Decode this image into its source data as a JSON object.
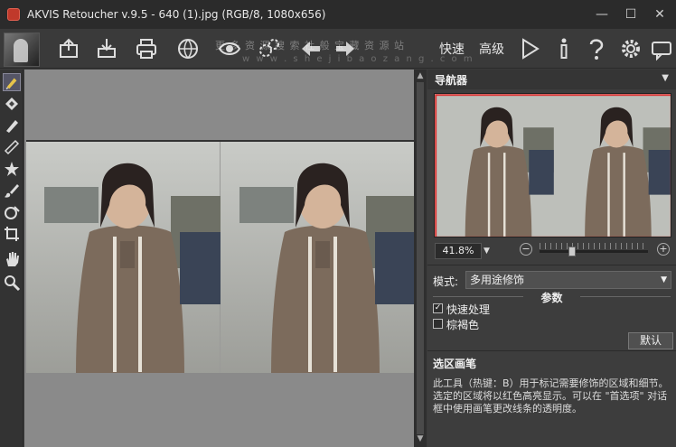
{
  "window": {
    "title": "AKVIS Retoucher v.9.5 - 640 (1).jpg (RGB/8, 1080x656)",
    "minimize": "—",
    "maximize": "☐",
    "close": "✕"
  },
  "toolbar": {
    "quick_label": "快速",
    "advanced_label": "高级",
    "watermark_top": "更 多 资 源 搜 索 社 般 宝 藏 资 源 站",
    "watermark_bottom": "w w w . s h e j i b a o z a n g . c o m"
  },
  "left_tools": [
    "selection-brush",
    "eraser",
    "pencil",
    "ruler",
    "star-stamp",
    "brush",
    "paint-bucket",
    "crop",
    "hand",
    "zoom"
  ],
  "navigator": {
    "title": "导航器",
    "zoom_value": "41.8%",
    "zoom_level": 0.3
  },
  "settings": {
    "mode_label": "模式:",
    "mode_value": "多用途修饰",
    "params_title": "参数",
    "fast_processing": {
      "label": "快速处理",
      "checked": true
    },
    "sepia": {
      "label": "棕褐色",
      "checked": false
    },
    "default_button": "默认"
  },
  "help": {
    "title": "选区画笔",
    "body": "此工具（热键：B）用于标记需要修饰的区域和细节。选定的区域将以红色高亮显示。可以在 \"首选项\" 对话框中使用画笔更改线条的透明度。"
  }
}
